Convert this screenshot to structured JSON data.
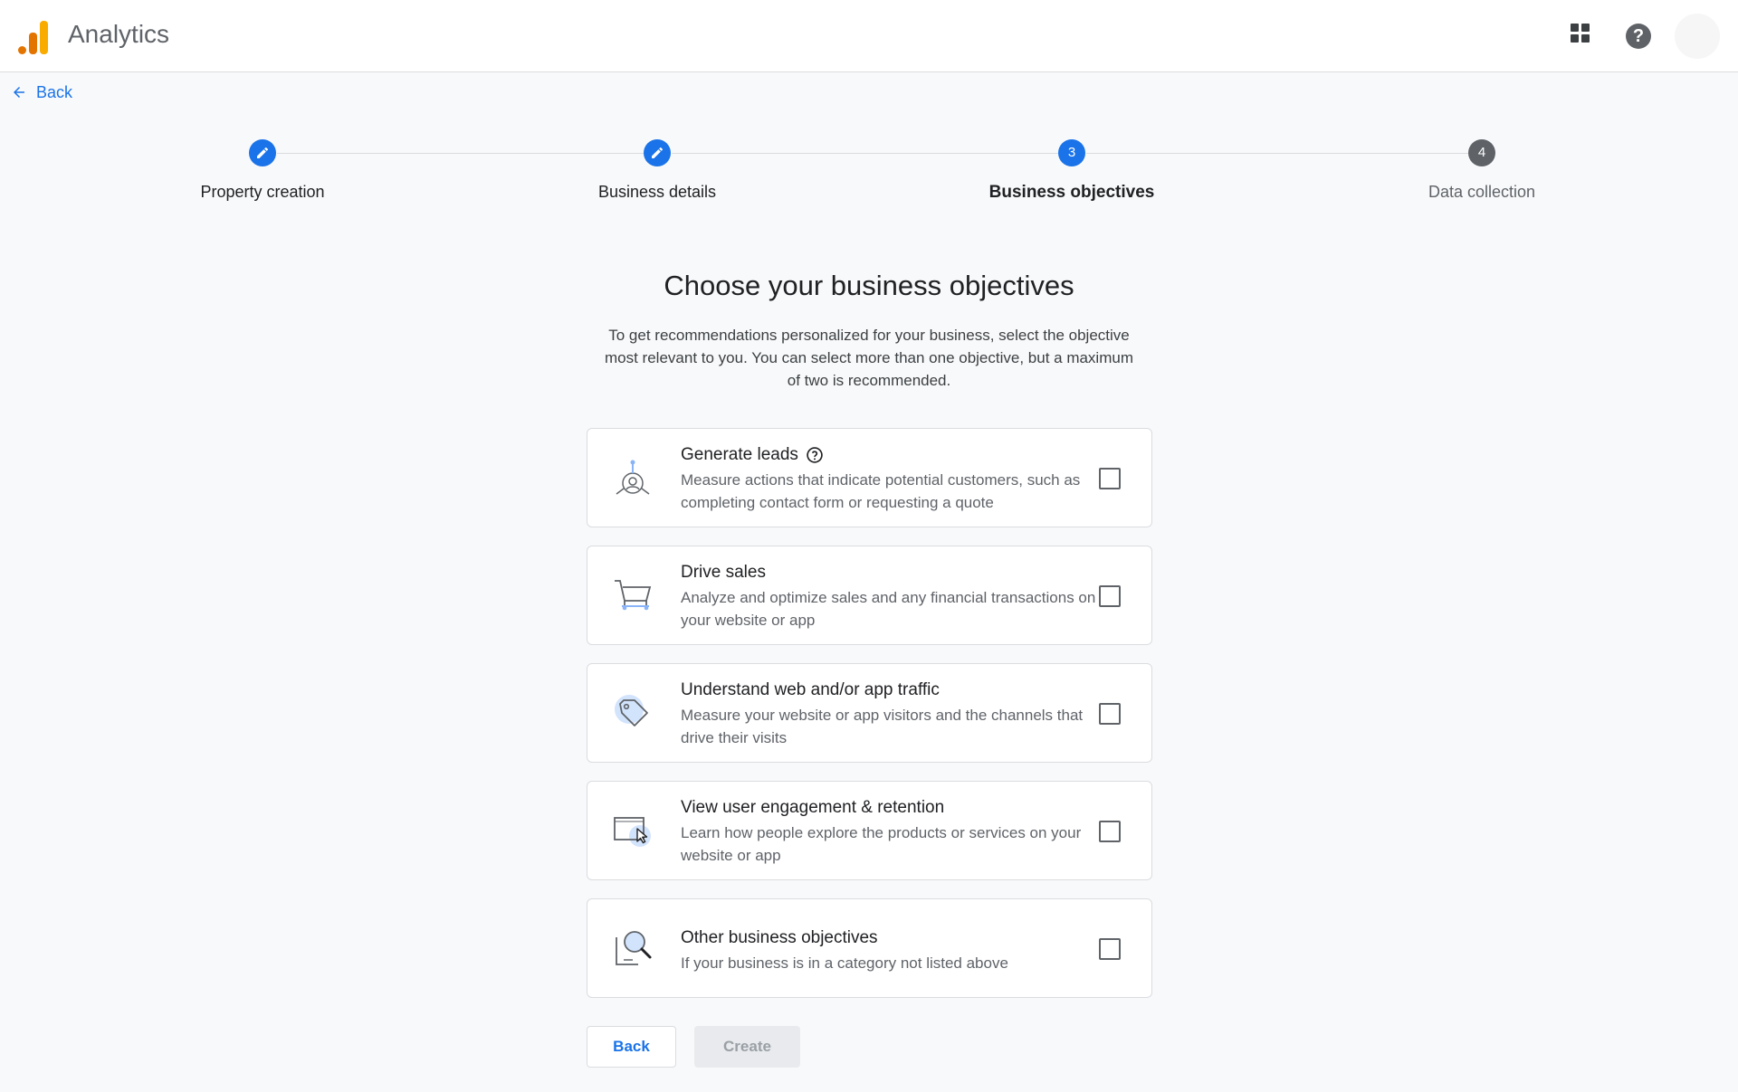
{
  "app": {
    "title": "Analytics"
  },
  "nav": {
    "back_label": "Back"
  },
  "stepper": {
    "steps": [
      {
        "label": "Property creation",
        "state": "done",
        "number": ""
      },
      {
        "label": "Business details",
        "state": "done",
        "number": ""
      },
      {
        "label": "Business objectives",
        "state": "active",
        "number": "3"
      },
      {
        "label": "Data collection",
        "state": "todo",
        "number": "4"
      }
    ]
  },
  "main": {
    "title": "Choose your business objectives",
    "subtitle": "To get recommendations personalized for your business, select the objective most relevant to you. You can select more than one objective, but a maximum of two is recommended."
  },
  "objectives": [
    {
      "title": "Generate leads",
      "description": "Measure actions that indicate potential customers, such as completing contact form or requesting a quote",
      "icon": "leads-icon",
      "checked": false
    },
    {
      "title": "Drive sales",
      "description": "Analyze and optimize sales and any financial transactions on your website or app",
      "icon": "cart-icon",
      "checked": false
    },
    {
      "title": "Understand web and/or app traffic",
      "description": "Measure your website or app visitors and the channels that drive their visits",
      "icon": "tag-icon",
      "checked": false
    },
    {
      "title": "View user engagement & retention",
      "description": "Learn how people explore the products or services on your website or app",
      "icon": "window-cursor-icon",
      "checked": false
    },
    {
      "title": "Other business objectives",
      "description": "If your business is in a category not listed above",
      "icon": "magnifier-icon",
      "checked": false
    }
  ],
  "footer": {
    "back_label": "Back",
    "create_label": "Create"
  },
  "colors": {
    "accent": "#1a73e8",
    "brand_orange": "#e37400",
    "brand_yellow": "#f9ab00"
  }
}
